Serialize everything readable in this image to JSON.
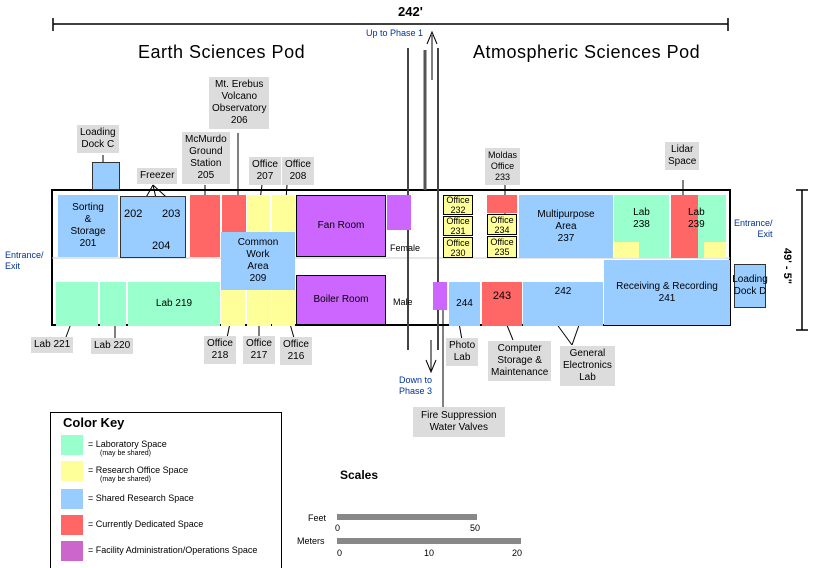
{
  "dimensions": {
    "length": "242'",
    "width": "49' - 5\""
  },
  "pods": {
    "earth": "Earth Sciences Pod",
    "atmospheric": "Atmospheric Sciences Pod"
  },
  "navigation": {
    "up": "Up to Phase 1",
    "down_line1": "Down to",
    "down_line2": "Phase 3",
    "entrance_left_1": "Entrance/",
    "entrance_left_2": "Exit",
    "entrance_right_1": "Entrance/",
    "entrance_right_2": "Exit"
  },
  "callouts": {
    "loading_dock_c": [
      "Loading",
      "Dock C"
    ],
    "freezer": "Freezer",
    "mcmurdo": [
      "McMurdo",
      "Ground",
      "Station",
      "205"
    ],
    "erebus": [
      "Mt. Erebus",
      "Volcano",
      "Observatory",
      "206"
    ],
    "office_207": [
      "Office",
      "207"
    ],
    "office_208": [
      "Office",
      "208"
    ],
    "moldas": [
      "Moldas",
      "Office",
      "233"
    ],
    "lidar": [
      "Lidar",
      "Space"
    ],
    "lab_221": "Lab 221",
    "lab_220": "Lab 220",
    "office_218": [
      "Office",
      "218"
    ],
    "office_217": [
      "Office",
      "217"
    ],
    "office_216": [
      "Office",
      "216"
    ],
    "photo_lab": [
      "Photo",
      "Lab"
    ],
    "computer_storage": [
      "Computer",
      "Storage &",
      "Maintenance"
    ],
    "general_electronics": [
      "General",
      "Electronics",
      "Lab"
    ],
    "fire_suppression": [
      "Fire Suppression",
      "Water Valves"
    ]
  },
  "rooms": {
    "r201": [
      "Sorting",
      "&",
      "Storage",
      "201"
    ],
    "r202": "202",
    "r203": "203",
    "r204": "204",
    "r209": [
      "Common",
      "Work",
      "Area",
      "209"
    ],
    "r219": "Lab 219",
    "fan": "Fan Room",
    "boiler": "Boiler Room",
    "female": "Female",
    "male": "Male",
    "r232": [
      "Office",
      "232"
    ],
    "r231": [
      "Office",
      "231"
    ],
    "r230": [
      "Office",
      "230"
    ],
    "r234": [
      "Office",
      "234"
    ],
    "r235": [
      "Office",
      "235"
    ],
    "r237": [
      "Multipurpose",
      "Area",
      "237"
    ],
    "r238": [
      "Lab",
      "238"
    ],
    "r239": [
      "Lab",
      "239"
    ],
    "r241": [
      "Receiving & Recording",
      "241"
    ],
    "r242": "242",
    "r243": "243",
    "r244": "244",
    "dock_d": [
      "Loading",
      "Dock D"
    ]
  },
  "color_key": {
    "title": "Color Key",
    "items": [
      {
        "label": "= Laboratory Space",
        "sub": "(may be shared)",
        "color": "#99ffcc"
      },
      {
        "label": "= Research Office Space",
        "sub": "(may be shared)",
        "color": "#ffff99"
      },
      {
        "label": "= Shared Research Space",
        "sub": "",
        "color": "#99ccff"
      },
      {
        "label": "= Currently Dedicated Space",
        "sub": "",
        "color": "#ff6666"
      },
      {
        "label": "= Facility Administration/Operations Space",
        "sub": "",
        "color": "#cc66cc"
      }
    ]
  },
  "scales": {
    "title": "Scales",
    "feet_label": "Feet",
    "feet_ticks": [
      "0",
      "50"
    ],
    "meters_label": "Meters",
    "meters_ticks": [
      "0",
      "10",
      "20"
    ]
  }
}
